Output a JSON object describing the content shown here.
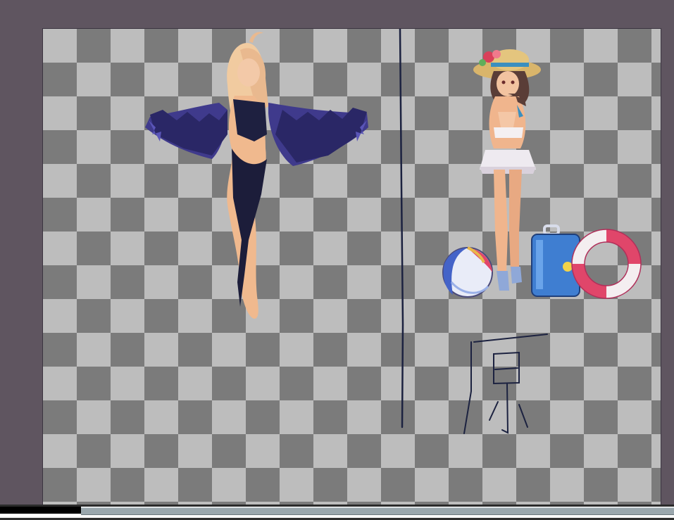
{
  "app": {
    "workspace_bg": "#5f5560",
    "checker_light": "#bdbdbd",
    "checker_dark": "#7b7b7b"
  },
  "canvas": {
    "content": [
      {
        "kind": "pixel-sprite",
        "icon": "dark-winged-blonde-character-sprite"
      },
      {
        "kind": "pixel-sprite",
        "icon": "swimsuit-girl-sun-hat-sprite"
      },
      {
        "kind": "pixel-sprite",
        "icon": "beach-ball-sprite"
      },
      {
        "kind": "pixel-sprite",
        "icon": "blue-suitcase-sprite"
      },
      {
        "kind": "pixel-sprite",
        "icon": "life-ring-sprite"
      },
      {
        "kind": "brush-stroke",
        "icon": "divider-stroke"
      }
    ],
    "handwritten_text": "原"
  },
  "scrollbar": {
    "thumb_color": "#9aa7ad"
  }
}
